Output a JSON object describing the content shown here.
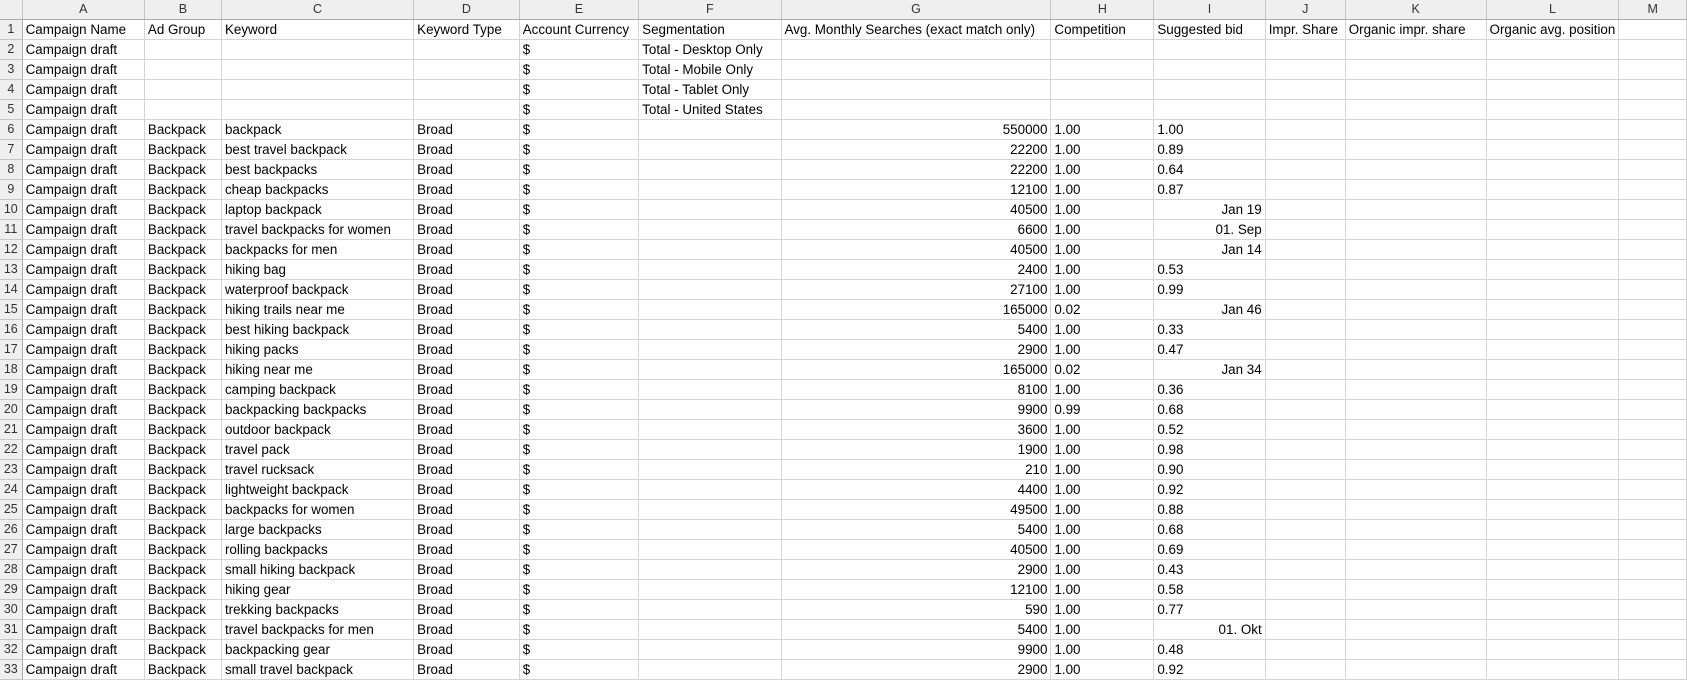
{
  "columns": [
    "A",
    "B",
    "C",
    "D",
    "E",
    "F",
    "G",
    "H",
    "I",
    "J",
    "K",
    "L",
    "M"
  ],
  "header_row": {
    "row": "1",
    "cells": [
      "Campaign Name",
      "Ad Group",
      "Keyword",
      "Keyword Type",
      "Account Currency",
      "Segmentation",
      "Avg. Monthly Searches (exact match only)",
      "Competition",
      "Suggested bid",
      "Impr. Share",
      "Organic impr. share",
      "Organic avg. position",
      ""
    ]
  },
  "rows": [
    {
      "row": "2",
      "campaign": "Campaign draft",
      "ad_group": "",
      "keyword": "",
      "type": "",
      "currency": "$",
      "segmentation": "Total - Desktop Only",
      "searches": "",
      "competition": "",
      "bid": ""
    },
    {
      "row": "3",
      "campaign": "Campaign draft",
      "ad_group": "",
      "keyword": "",
      "type": "",
      "currency": "$",
      "segmentation": "Total - Mobile Only",
      "searches": "",
      "competition": "",
      "bid": ""
    },
    {
      "row": "4",
      "campaign": "Campaign draft",
      "ad_group": "",
      "keyword": "",
      "type": "",
      "currency": "$",
      "segmentation": "Total - Tablet Only",
      "searches": "",
      "competition": "",
      "bid": ""
    },
    {
      "row": "5",
      "campaign": "Campaign draft",
      "ad_group": "",
      "keyword": "",
      "type": "",
      "currency": "$",
      "segmentation": "Total - United States",
      "searches": "",
      "competition": "",
      "bid": ""
    },
    {
      "row": "6",
      "campaign": "Campaign draft",
      "ad_group": "Backpack",
      "keyword": "backpack",
      "type": "Broad",
      "currency": "$",
      "segmentation": "",
      "searches": "550000",
      "competition": "1.00",
      "bid": "1.00"
    },
    {
      "row": "7",
      "campaign": "Campaign draft",
      "ad_group": "Backpack",
      "keyword": "best travel backpack",
      "type": "Broad",
      "currency": "$",
      "segmentation": "",
      "searches": "22200",
      "competition": "1.00",
      "bid": "0.89"
    },
    {
      "row": "8",
      "campaign": "Campaign draft",
      "ad_group": "Backpack",
      "keyword": "best backpacks",
      "type": "Broad",
      "currency": "$",
      "segmentation": "",
      "searches": "22200",
      "competition": "1.00",
      "bid": "0.64"
    },
    {
      "row": "9",
      "campaign": "Campaign draft",
      "ad_group": "Backpack",
      "keyword": "cheap backpacks",
      "type": "Broad",
      "currency": "$",
      "segmentation": "",
      "searches": "12100",
      "competition": "1.00",
      "bid": "0.87"
    },
    {
      "row": "10",
      "campaign": "Campaign draft",
      "ad_group": "Backpack",
      "keyword": "laptop backpack",
      "type": "Broad",
      "currency": "$",
      "segmentation": "",
      "searches": "40500",
      "competition": "1.00",
      "bid": "Jan 19"
    },
    {
      "row": "11",
      "campaign": "Campaign draft",
      "ad_group": "Backpack",
      "keyword": "travel backpacks for women",
      "type": "Broad",
      "currency": "$",
      "segmentation": "",
      "searches": "6600",
      "competition": "1.00",
      "bid": "01. Sep"
    },
    {
      "row": "12",
      "campaign": "Campaign draft",
      "ad_group": "Backpack",
      "keyword": "backpacks for men",
      "type": "Broad",
      "currency": "$",
      "segmentation": "",
      "searches": "40500",
      "competition": "1.00",
      "bid": "Jan 14"
    },
    {
      "row": "13",
      "campaign": "Campaign draft",
      "ad_group": "Backpack",
      "keyword": "hiking bag",
      "type": "Broad",
      "currency": "$",
      "segmentation": "",
      "searches": "2400",
      "competition": "1.00",
      "bid": "0.53"
    },
    {
      "row": "14",
      "campaign": "Campaign draft",
      "ad_group": "Backpack",
      "keyword": "waterproof backpack",
      "type": "Broad",
      "currency": "$",
      "segmentation": "",
      "searches": "27100",
      "competition": "1.00",
      "bid": "0.99"
    },
    {
      "row": "15",
      "campaign": "Campaign draft",
      "ad_group": "Backpack",
      "keyword": "hiking trails near me",
      "type": "Broad",
      "currency": "$",
      "segmentation": "",
      "searches": "165000",
      "competition": "0.02",
      "bid": "Jan 46"
    },
    {
      "row": "16",
      "campaign": "Campaign draft",
      "ad_group": "Backpack",
      "keyword": "best hiking backpack",
      "type": "Broad",
      "currency": "$",
      "segmentation": "",
      "searches": "5400",
      "competition": "1.00",
      "bid": "0.33"
    },
    {
      "row": "17",
      "campaign": "Campaign draft",
      "ad_group": "Backpack",
      "keyword": "hiking packs",
      "type": "Broad",
      "currency": "$",
      "segmentation": "",
      "searches": "2900",
      "competition": "1.00",
      "bid": "0.47"
    },
    {
      "row": "18",
      "campaign": "Campaign draft",
      "ad_group": "Backpack",
      "keyword": "hiking near me",
      "type": "Broad",
      "currency": "$",
      "segmentation": "",
      "searches": "165000",
      "competition": "0.02",
      "bid": "Jan 34"
    },
    {
      "row": "19",
      "campaign": "Campaign draft",
      "ad_group": "Backpack",
      "keyword": "camping backpack",
      "type": "Broad",
      "currency": "$",
      "segmentation": "",
      "searches": "8100",
      "competition": "1.00",
      "bid": "0.36"
    },
    {
      "row": "20",
      "campaign": "Campaign draft",
      "ad_group": "Backpack",
      "keyword": "backpacking backpacks",
      "type": "Broad",
      "currency": "$",
      "segmentation": "",
      "searches": "9900",
      "competition": "0.99",
      "bid": "0.68"
    },
    {
      "row": "21",
      "campaign": "Campaign draft",
      "ad_group": "Backpack",
      "keyword": "outdoor backpack",
      "type": "Broad",
      "currency": "$",
      "segmentation": "",
      "searches": "3600",
      "competition": "1.00",
      "bid": "0.52"
    },
    {
      "row": "22",
      "campaign": "Campaign draft",
      "ad_group": "Backpack",
      "keyword": "travel pack",
      "type": "Broad",
      "currency": "$",
      "segmentation": "",
      "searches": "1900",
      "competition": "1.00",
      "bid": "0.98"
    },
    {
      "row": "23",
      "campaign": "Campaign draft",
      "ad_group": "Backpack",
      "keyword": "travel rucksack",
      "type": "Broad",
      "currency": "$",
      "segmentation": "",
      "searches": "210",
      "competition": "1.00",
      "bid": "0.90"
    },
    {
      "row": "24",
      "campaign": "Campaign draft",
      "ad_group": "Backpack",
      "keyword": "lightweight backpack",
      "type": "Broad",
      "currency": "$",
      "segmentation": "",
      "searches": "4400",
      "competition": "1.00",
      "bid": "0.92"
    },
    {
      "row": "25",
      "campaign": "Campaign draft",
      "ad_group": "Backpack",
      "keyword": "backpacks for women",
      "type": "Broad",
      "currency": "$",
      "segmentation": "",
      "searches": "49500",
      "competition": "1.00",
      "bid": "0.88"
    },
    {
      "row": "26",
      "campaign": "Campaign draft",
      "ad_group": "Backpack",
      "keyword": "large backpacks",
      "type": "Broad",
      "currency": "$",
      "segmentation": "",
      "searches": "5400",
      "competition": "1.00",
      "bid": "0.68"
    },
    {
      "row": "27",
      "campaign": "Campaign draft",
      "ad_group": "Backpack",
      "keyword": "rolling backpacks",
      "type": "Broad",
      "currency": "$",
      "segmentation": "",
      "searches": "40500",
      "competition": "1.00",
      "bid": "0.69"
    },
    {
      "row": "28",
      "campaign": "Campaign draft",
      "ad_group": "Backpack",
      "keyword": "small hiking backpack",
      "type": "Broad",
      "currency": "$",
      "segmentation": "",
      "searches": "2900",
      "competition": "1.00",
      "bid": "0.43"
    },
    {
      "row": "29",
      "campaign": "Campaign draft",
      "ad_group": "Backpack",
      "keyword": "hiking gear",
      "type": "Broad",
      "currency": "$",
      "segmentation": "",
      "searches": "12100",
      "competition": "1.00",
      "bid": "0.58"
    },
    {
      "row": "30",
      "campaign": "Campaign draft",
      "ad_group": "Backpack",
      "keyword": "trekking backpacks",
      "type": "Broad",
      "currency": "$",
      "segmentation": "",
      "searches": "590",
      "competition": "1.00",
      "bid": "0.77"
    },
    {
      "row": "31",
      "campaign": "Campaign draft",
      "ad_group": "Backpack",
      "keyword": "travel backpacks for men",
      "type": "Broad",
      "currency": "$",
      "segmentation": "",
      "searches": "5400",
      "competition": "1.00",
      "bid": "01. Okt"
    },
    {
      "row": "32",
      "campaign": "Campaign draft",
      "ad_group": "Backpack",
      "keyword": "backpacking gear",
      "type": "Broad",
      "currency": "$",
      "segmentation": "",
      "searches": "9900",
      "competition": "1.00",
      "bid": "0.48"
    },
    {
      "row": "33",
      "campaign": "Campaign draft",
      "ad_group": "Backpack",
      "keyword": "small travel backpack",
      "type": "Broad",
      "currency": "$",
      "segmentation": "",
      "searches": "2900",
      "competition": "1.00",
      "bid": "0.92"
    }
  ]
}
